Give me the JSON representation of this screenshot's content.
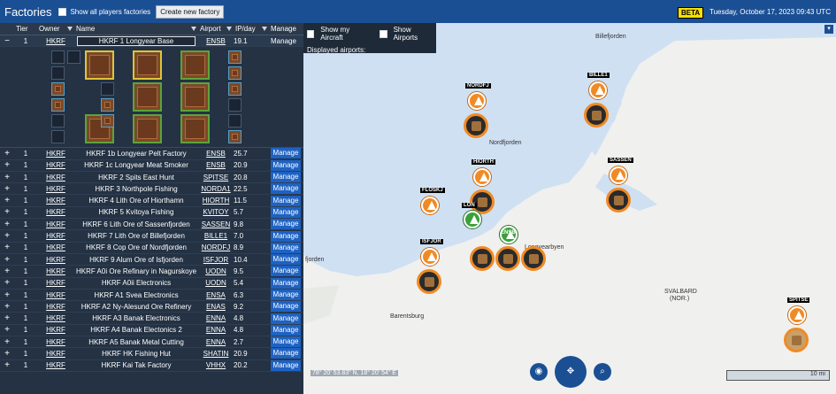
{
  "app": {
    "title": "Factories",
    "show_all_label": "Show all players factories",
    "new_factory_label": "Create new factory",
    "beta": "BETA",
    "date": "Tuesday, October 17, 2023 09:43 UTC"
  },
  "table": {
    "headers": {
      "tier": "Tier",
      "owner": "Owner",
      "name": "Name",
      "airport": "Airport",
      "ipday": "IP/day",
      "manage": "Manage"
    },
    "expanded_row": {
      "toggle": "−",
      "tier": "1",
      "owner": "HKRF",
      "name": "HKRF 1 Longyear Base",
      "airport": "ENSB",
      "ipday": "19.1",
      "manage": "Manage"
    },
    "rows": [
      {
        "toggle": "+",
        "tier": "1",
        "owner": "HKRF",
        "name": "HKRF 1b Longyear Pelt Factory",
        "airport": "ENSB",
        "ipday": "25.7",
        "manage": "Manage"
      },
      {
        "toggle": "+",
        "tier": "1",
        "owner": "HKRF",
        "name": "HKRF 1c Longyear Meat Smoker",
        "airport": "ENSB",
        "ipday": "20.9",
        "manage": "Manage"
      },
      {
        "toggle": "+",
        "tier": "1",
        "owner": "HKRF",
        "name": "HKRF 2 Spits East Hunt",
        "airport": "SPITSE",
        "ipday": "20.8",
        "manage": "Manage"
      },
      {
        "toggle": "+",
        "tier": "1",
        "owner": "HKRF",
        "name": "HKRF 3 Northpole Fishing",
        "airport": "NORDA1",
        "ipday": "22.5",
        "manage": "Manage"
      },
      {
        "toggle": "+",
        "tier": "1",
        "owner": "HKRF",
        "name": "HKRF 4 Lith Ore of Hiorthamn",
        "airport": "HIORTH",
        "ipday": "11.5",
        "manage": "Manage"
      },
      {
        "toggle": "+",
        "tier": "1",
        "owner": "HKRF",
        "name": "HKRF 5 Kvitoya Fishing",
        "airport": "KVITOY",
        "ipday": "5.7",
        "manage": "Manage"
      },
      {
        "toggle": "+",
        "tier": "1",
        "owner": "HKRF",
        "name": "HKRF 6 Lith Ore of Sassenfjorden",
        "airport": "SASSEN",
        "ipday": "9.8",
        "manage": "Manage"
      },
      {
        "toggle": "+",
        "tier": "1",
        "owner": "HKRF",
        "name": "HKRF 7 Lith Ore of Billefjorden",
        "airport": "BILLE1",
        "ipday": "7.0",
        "manage": "Manage"
      },
      {
        "toggle": "+",
        "tier": "1",
        "owner": "HKRF",
        "name": "HKRF 8 Cop Ore of Nordfjorden",
        "airport": "NORDFJ",
        "ipday": "8.9",
        "manage": "Manage"
      },
      {
        "toggle": "+",
        "tier": "1",
        "owner": "HKRF",
        "name": "HKRF 9 Alum Ore of Isfjorden",
        "airport": "ISFJOR",
        "ipday": "10.4",
        "manage": "Manage"
      },
      {
        "toggle": "+",
        "tier": "1",
        "owner": "HKRF",
        "name": "HKRF A0i Ore Refinary in Nagurskoye",
        "airport": "UODN",
        "ipday": "9.5",
        "manage": "Manage"
      },
      {
        "toggle": "+",
        "tier": "1",
        "owner": "HKRF",
        "name": "HKRF A0ii Electronics",
        "airport": "UODN",
        "ipday": "5.4",
        "manage": "Manage"
      },
      {
        "toggle": "+",
        "tier": "1",
        "owner": "HKRF",
        "name": "HKRF A1 Svea Electronics",
        "airport": "ENSA",
        "ipday": "6.3",
        "manage": "Manage"
      },
      {
        "toggle": "+",
        "tier": "1",
        "owner": "HKRF",
        "name": "HKRF A2 Ny-Alesund Ore Refinery",
        "airport": "ENAS",
        "ipday": "9.2",
        "manage": "Manage"
      },
      {
        "toggle": "+",
        "tier": "1",
        "owner": "HKRF",
        "name": "HKRF A3 Banak Electronics",
        "airport": "ENNA",
        "ipday": "4.8",
        "manage": "Manage"
      },
      {
        "toggle": "+",
        "tier": "1",
        "owner": "HKRF",
        "name": "HKRF A4 Banak Electonics 2",
        "airport": "ENNA",
        "ipday": "4.8",
        "manage": "Manage"
      },
      {
        "toggle": "+",
        "tier": "1",
        "owner": "HKRF",
        "name": "HKRF A5 Banak Metal Cutting",
        "airport": "ENNA",
        "ipday": "2.7",
        "manage": "Manage"
      },
      {
        "toggle": "+",
        "tier": "1",
        "owner": "HKRF",
        "name": "HKRF HK Fishing Hut",
        "airport": "SHATIN",
        "ipday": "20.9",
        "manage": "Manage"
      },
      {
        "toggle": "+",
        "tier": "1",
        "owner": "HKRF",
        "name": "HKRF Kai Tak Factory",
        "airport": "VHHX",
        "ipday": "20.2",
        "manage": "Manage"
      }
    ]
  },
  "map": {
    "show_aircraft_label": "Show my Aircraft",
    "show_airports_label": "Show Airports",
    "displayed_airports_label": "Displayed airports:",
    "place_labels": {
      "billefjorden": "Billefjorden",
      "nordfjorden": "Nordfjorden",
      "longyearbyen": "Longyearbyen",
      "svalbard": "SVALBARD",
      "svalbard_sub": "(NOR.)",
      "barentsburg": "Barentsburg",
      "fjorden": "fjorden"
    },
    "airport_labels": {
      "nordfj": "NORDFJ",
      "bille1": "BILLE1",
      "hiorth": "HIORTH",
      "sassen": "SASSEN",
      "floskj": "FLOSKJ",
      "lon": "LON",
      "ensb": "ENSB",
      "isfjor": "ISFJOR",
      "spitse": "SPITSE"
    },
    "coords": "78° 20' 53.83\" N, 18° 20' 54\" E",
    "scale": "10 mi"
  },
  "colors": {
    "topbar": "#1b4f93",
    "manage_button": "#1e62c2",
    "marker_orange": "#f08a24",
    "marker_green": "#3aa13a",
    "water": "#cfe0f3"
  }
}
